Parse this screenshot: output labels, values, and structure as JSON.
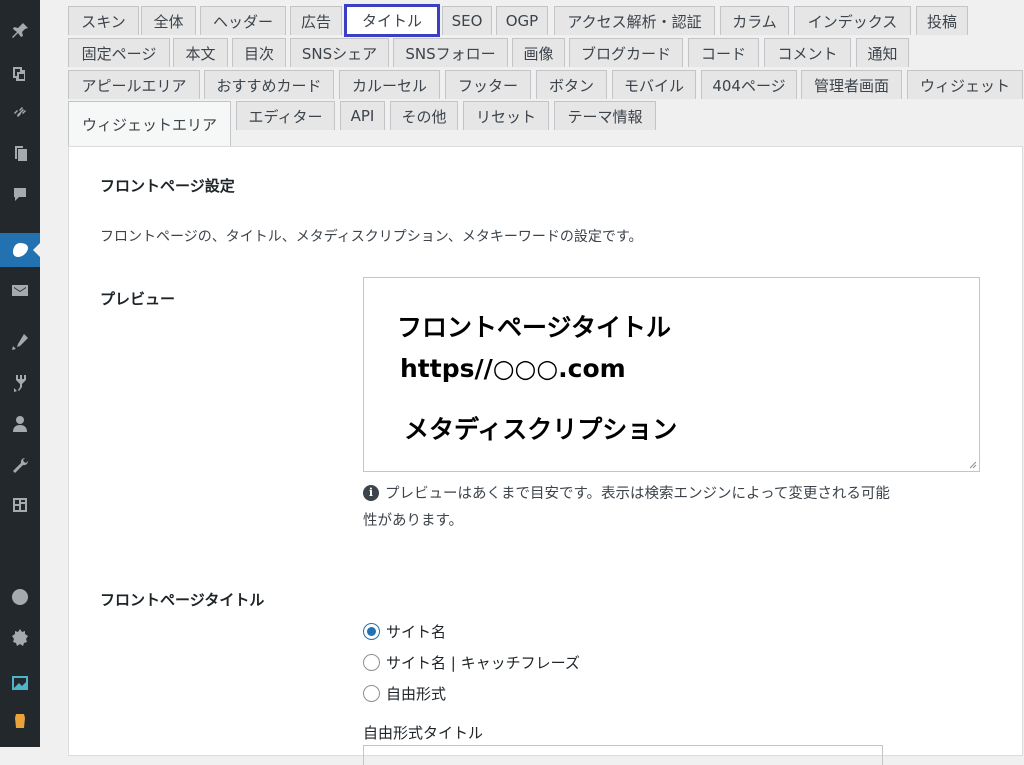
{
  "sidebar": {
    "icons": [
      "pin-icon",
      "media-icon",
      "link-icon",
      "pages-icon",
      "comments-icon",
      "theme-icon",
      "mail-icon",
      "appearance-icon",
      "plugins-icon",
      "users-icon",
      "tools-icon",
      "settings-icon",
      "plugin-icon-1",
      "plugin-icon-2",
      "plugin-icon-3",
      "plugin-icon-4"
    ]
  },
  "tabs": {
    "row1": [
      "スキン",
      "全体",
      "ヘッダー",
      "広告",
      "タイトル",
      "SEO",
      "OGP",
      "アクセス解析・認証",
      "カラム",
      "インデックス",
      "投稿"
    ],
    "row2": [
      "固定ページ",
      "本文",
      "目次",
      "SNSシェア",
      "SNSフォロー",
      "画像",
      "ブログカード",
      "コード",
      "コメント",
      "通知"
    ],
    "row3": [
      "アピールエリア",
      "おすすめカード",
      "カルーセル",
      "フッター",
      "ボタン",
      "モバイル",
      "404ページ",
      "管理者画面",
      "ウィジェット"
    ],
    "row4": [
      "ウィジェットエリア",
      "エディター",
      "API",
      "その他",
      "リセット",
      "テーマ情報"
    ],
    "active": "タイトル"
  },
  "panel": {
    "section_title": "フロントページ設定",
    "section_desc": "フロントページの、タイトル、メタディスクリプション、メタキーワードの設定です。",
    "preview_label": "プレビュー",
    "preview": {
      "title": "フロントページタイトル",
      "url": "https//○○○.com",
      "description": "メタディスクリプション"
    },
    "preview_note_line1": "プレビューはあくまで目安です。表示は検索エンジンによって変更される可能",
    "preview_note_line2": "性があります。",
    "front_title_label": "フロントページタイトル",
    "radios": [
      {
        "label": "サイト名",
        "checked": true
      },
      {
        "label": "サイト名 | キャッチフレーズ",
        "checked": false
      },
      {
        "label": "自由形式",
        "checked": false
      }
    ],
    "free_title_label": "自由形式タイトル"
  },
  "colors": {
    "highlight_border": "#3b3fc4",
    "sidebar_bg": "#23282d",
    "radio_checked": "#2271b1"
  }
}
